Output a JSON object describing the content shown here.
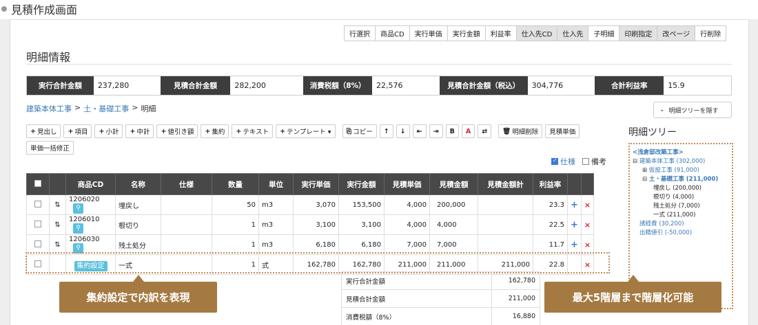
{
  "page_title": "見積作成画面",
  "top_buttons": [
    {
      "label": "行選択",
      "style": "normal"
    },
    {
      "label": "商品CD",
      "style": "normal"
    },
    {
      "label": "実行単価",
      "style": "normal"
    },
    {
      "label": "実行金額",
      "style": "normal"
    },
    {
      "label": "利益率",
      "style": "normal"
    },
    {
      "label": "仕入先CD",
      "style": "gray"
    },
    {
      "label": "仕入先",
      "style": "gray"
    },
    {
      "label": "子明細",
      "style": "normal"
    },
    {
      "label": "印刷指定",
      "style": "gray"
    },
    {
      "label": "改ページ",
      "style": "gray"
    },
    {
      "label": "行削除",
      "style": "normal"
    }
  ],
  "section_title": "明細情報",
  "summary": [
    {
      "label": "実行合計金額",
      "value": "237,280"
    },
    {
      "label": "見積合計金額",
      "value": "282,200"
    },
    {
      "label": "消費税額（8%）",
      "value": "22,576"
    },
    {
      "label": "見積合計金額（税込）",
      "value": "304,776"
    },
    {
      "label": "合計利益率",
      "value": "15.9"
    }
  ],
  "breadcrumb": {
    "item1": "建築本体工事",
    "item2": "土・基礎工事",
    "current": "明細",
    "sep": ">"
  },
  "tree_toggle_label": "明細ツリーを隠す",
  "toolbar": [
    {
      "icon": "+",
      "label": "見出し"
    },
    {
      "icon": "+",
      "label": "項目"
    },
    {
      "icon": "+",
      "label": "小計"
    },
    {
      "icon": "+",
      "label": "中計"
    },
    {
      "icon": "+",
      "label": "値引き額"
    },
    {
      "icon": "+",
      "label": "集約"
    },
    {
      "icon": "+",
      "label": "テキスト"
    },
    {
      "icon": "+",
      "label": "テンプレート ▾"
    },
    {
      "icon": "⎘",
      "label": "コピー"
    },
    {
      "icon": "↑",
      "label": ""
    },
    {
      "icon": "↓",
      "label": ""
    },
    {
      "icon": "⇤",
      "label": ""
    },
    {
      "icon": "⇥",
      "label": ""
    },
    {
      "icon": "B",
      "label": ""
    },
    {
      "icon": "A",
      "label": ""
    },
    {
      "icon": "⇄",
      "label": ""
    },
    {
      "icon": "🗑",
      "label": "明細削除"
    },
    {
      "icon": "",
      "label": "見積単価"
    },
    {
      "icon": "",
      "label": "単価一括修正"
    }
  ],
  "options": {
    "spec_label": "仕様",
    "spec_checked": true,
    "note_label": "備考",
    "note_checked": false
  },
  "table": {
    "headers": [
      "",
      "",
      "商品CD",
      "名称",
      "仕様",
      "数量",
      "単位",
      "実行単価",
      "実行金額",
      "見積単価",
      "見積金額",
      "見積金額計",
      "利益率",
      "",
      ""
    ],
    "rows": [
      {
        "code": "1206020",
        "name": "埋戻し",
        "spec": "",
        "qty": "50",
        "unit": "m3",
        "exec_price": "3,070",
        "exec_amount": "153,500",
        "est_price": "4,000",
        "est_amount": "200,000",
        "est_total": "",
        "margin": "23.3",
        "plus": "+",
        "del": "×",
        "aggregate": false
      },
      {
        "code": "1206010",
        "name": "根切り",
        "spec": "",
        "qty": "1",
        "unit": "m3",
        "exec_price": "3,100",
        "exec_amount": "3,100",
        "est_price": "4,000",
        "est_amount": "4,000",
        "est_total": "",
        "margin": "22.5",
        "plus": "+",
        "del": "×",
        "aggregate": false
      },
      {
        "code": "1206030",
        "name": "残土処分",
        "spec": "",
        "qty": "1",
        "unit": "m3",
        "exec_price": "6,180",
        "exec_amount": "6,180",
        "est_price": "7,000",
        "est_amount": "7,000",
        "est_total": "",
        "margin": "11.7",
        "plus": "+",
        "del": "×",
        "aggregate": false
      },
      {
        "code": "集約設定",
        "name": "一式",
        "spec": "",
        "qty": "1",
        "unit": "式",
        "exec_price": "162,780",
        "exec_amount": "162,780",
        "est_price": "211,000",
        "est_amount": "211,000",
        "est_total": "211,000",
        "margin": "22.8",
        "plus": "",
        "del": "×",
        "aggregate": true
      }
    ]
  },
  "agg_summary": [
    {
      "label": "実行合計金額",
      "value": "162,780"
    },
    {
      "label": "見積合計金額",
      "value": "211,000"
    },
    {
      "label": "消費税額（8%）",
      "value": "16,880"
    }
  ],
  "tree_title": "明細ツリー",
  "tree": [
    {
      "text": "<浅倉邸改築工事>",
      "level": 0,
      "style": "bb",
      "prefix": ""
    },
    {
      "text": "建築本体工事 (302,000)",
      "level": 0,
      "style": "b",
      "prefix": "⊟"
    },
    {
      "text": "仮設工事 (91,000)",
      "level": 1,
      "style": "b",
      "prefix": "⊞"
    },
    {
      "text": "土・基礎工事 (211,000)",
      "level": 1,
      "style": "bb",
      "prefix": "⊟"
    },
    {
      "text": "埋戻し (200,000)",
      "level": 2,
      "style": "k",
      "prefix": ""
    },
    {
      "text": "根切り (4,000)",
      "level": 2,
      "style": "k",
      "prefix": ""
    },
    {
      "text": "残土処分 (7,000)",
      "level": 2,
      "style": "k",
      "prefix": ""
    },
    {
      "text": "一式 (211,000)",
      "level": 2,
      "style": "k",
      "prefix": ""
    },
    {
      "text": "諸経費 (30,200)",
      "level": 0,
      "style": "b",
      "prefix": ""
    },
    {
      "text": "出精値引 (-50,000)",
      "level": 0,
      "style": "b",
      "prefix": ""
    }
  ],
  "callout_left": "集約設定で内訳を表現",
  "callout_right": "最大5階層まで階層化可能",
  "colors": {
    "header_dark": "#484848",
    "accent_blue": "#3a78b5",
    "callout": "#a57a42",
    "delete_red": "#d9262f"
  }
}
